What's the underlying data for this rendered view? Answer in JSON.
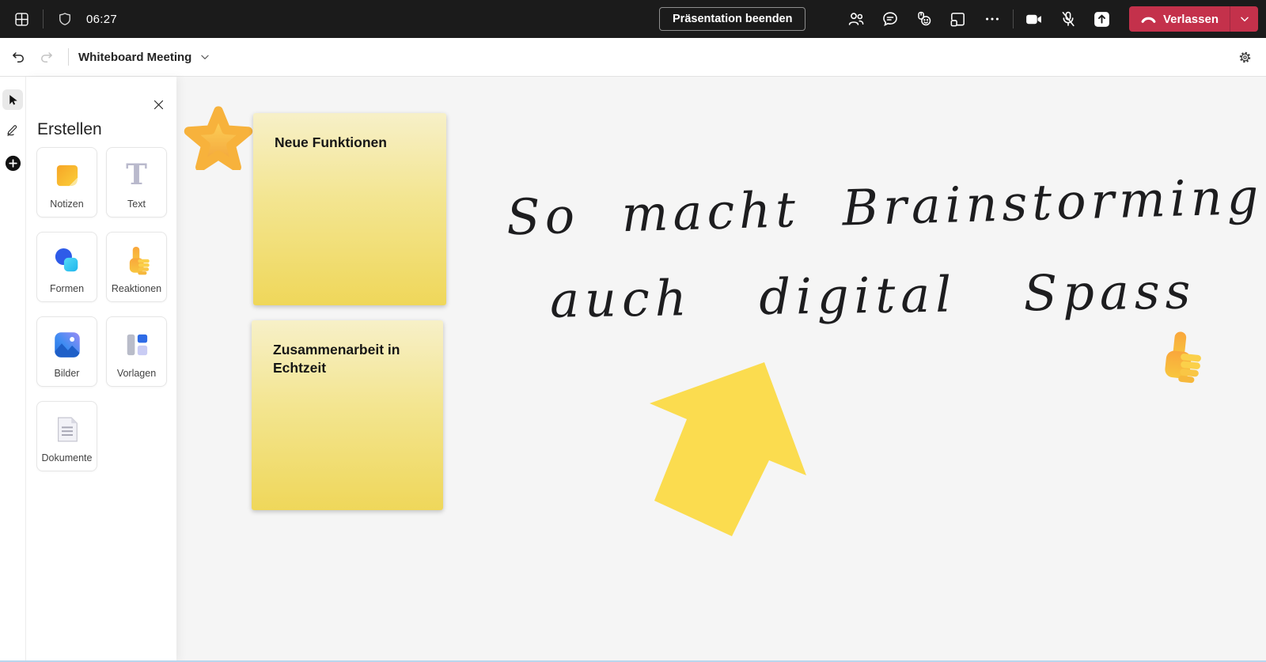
{
  "meeting_bar": {
    "bg_color": "#1b1b1b",
    "timer": "06:27",
    "stop_presenting_label": "Präsentation beenden",
    "leave_label": "Verlassen",
    "leave_color": "#C4314B",
    "icons": [
      "grid-layout",
      "shield",
      "participants",
      "chat",
      "reactions",
      "breakout-window",
      "more-options",
      "camera-on",
      "mic-off",
      "share-tray",
      "hang-up",
      "chevron-down"
    ]
  },
  "whiteboard_toolbar": {
    "title": "Whiteboard Meeting",
    "icons": [
      "undo",
      "redo",
      "chevron-down",
      "settings-gear"
    ],
    "undo_enabled": true,
    "redo_enabled": false
  },
  "tool_rail": {
    "icons": [
      "select-cursor",
      "inking-pen",
      "add-create"
    ],
    "selected_tool": "select-cursor"
  },
  "create_panel": {
    "heading": "Erstellen",
    "close_icon": "close-x",
    "tiles": [
      {
        "label": "Notizen",
        "icon": "sticky-note"
      },
      {
        "label": "Text",
        "icon": "text-T"
      },
      {
        "label": "Formen",
        "icon": "shapes"
      },
      {
        "label": "Reaktionen",
        "icon": "thumbs-up"
      },
      {
        "label": "Bilder",
        "icon": "image"
      },
      {
        "label": "Vorlagen",
        "icon": "template"
      },
      {
        "label": "Dokumente",
        "icon": "document"
      }
    ]
  },
  "canvas": {
    "bg_color": "#F5F5F5",
    "notes": [
      {
        "text": "Neue Funktionen",
        "color_top": "#F7F0C8",
        "color_bottom": "#EFD75A"
      },
      {
        "text": "Zusammenarbeit in Echtzeit",
        "color_top": "#F7F0C8",
        "color_bottom": "#EFD75A"
      }
    ],
    "handwriting": {
      "line1": "So macht Brainstorming",
      "line2": "auch digital Spass",
      "ink_color": "#1d1d1f"
    },
    "stickers": [
      {
        "name": "star-emoji",
        "color": "#FFC94D"
      },
      {
        "name": "arrow-shape",
        "color": "#FBDC4F"
      },
      {
        "name": "thumbs-up-emoji",
        "color": "#F9B23C"
      }
    ]
  }
}
